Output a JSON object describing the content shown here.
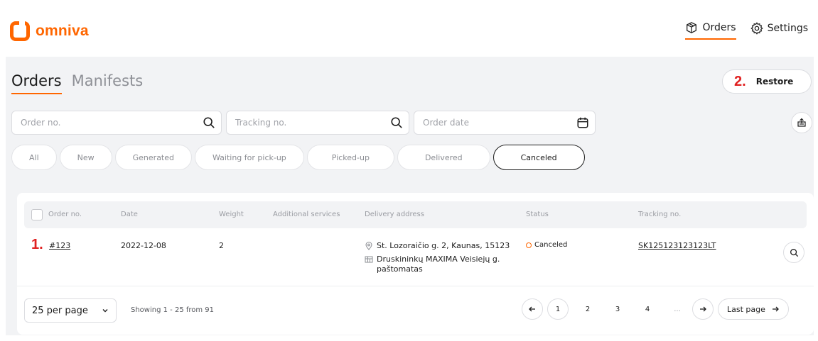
{
  "brand": {
    "name": "omniva",
    "color": "#ff6600"
  },
  "topnav": [
    {
      "label": "Orders",
      "icon": "box-icon",
      "active": true
    },
    {
      "label": "Settings",
      "icon": "gear-icon",
      "active": false
    }
  ],
  "tabs": [
    {
      "label": "Orders",
      "active": true
    },
    {
      "label": "Manifests",
      "active": false
    }
  ],
  "markers": {
    "one": "1.",
    "two": "2."
  },
  "restore_label": "Restore",
  "filters": {
    "order_placeholder": "Order no.",
    "tracking_placeholder": "Tracking no.",
    "date_placeholder": "Order date"
  },
  "status_chips": [
    {
      "label": "All",
      "active": false
    },
    {
      "label": "New",
      "active": false
    },
    {
      "label": "Generated",
      "active": false
    },
    {
      "label": "Waiting for pick-up",
      "active": false
    },
    {
      "label": "Picked-up",
      "active": false
    },
    {
      "label": "Delivered",
      "active": false
    },
    {
      "label": "Canceled",
      "active": true
    }
  ],
  "table": {
    "headers": {
      "order_no": "Order no.",
      "date": "Date",
      "weight": "Weight",
      "additional_services": "Additional services",
      "delivery_address": "Delivery address",
      "status": "Status",
      "tracking_no": "Tracking no."
    },
    "rows": [
      {
        "order_no": "#123",
        "date": "2022-12-08",
        "weight": "2",
        "additional_services": "",
        "address": "St. Lozoraičio g. 2, Kaunas, 15123",
        "parcel_machine": "Druskininkų MAXIMA Veisiejų g. paštomatas",
        "status": "Canceled",
        "tracking_no": "SK125123123123LT"
      }
    ]
  },
  "footer": {
    "per_page": "25 per page",
    "showing": "Showing 1 - 25 from 91",
    "pages": [
      "1",
      "2",
      "3",
      "4"
    ],
    "current_page": "1",
    "ellipsis": "...",
    "last_page": "Last page"
  }
}
